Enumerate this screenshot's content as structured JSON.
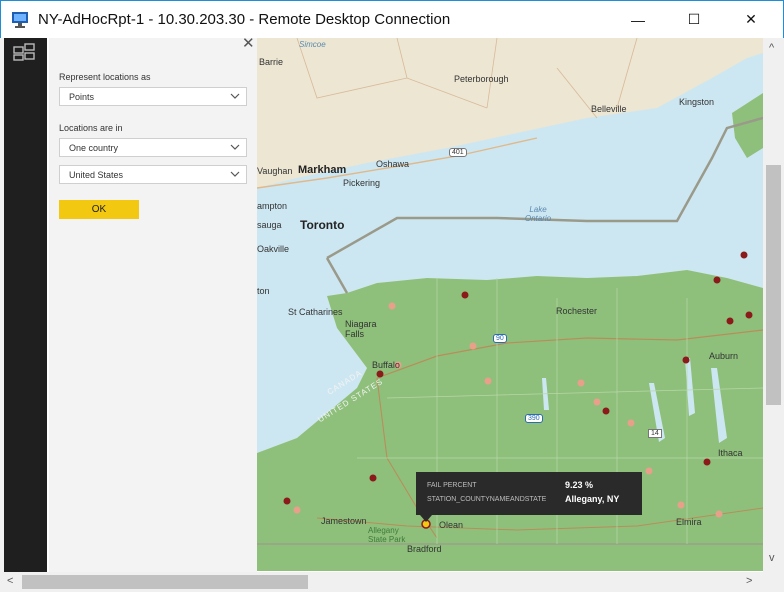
{
  "window": {
    "title": "NY-AdHocRpt-1 - 10.30.203.30 - Remote Desktop Connection",
    "controls": {
      "minimize": "—",
      "maximize": "☐",
      "close": "✕"
    }
  },
  "panel": {
    "close_glyph": "✕",
    "represent_label": "Represent locations as",
    "represent_value": "Points",
    "locations_label": "Locations are in",
    "scope_value": "One country",
    "country_value": "United States",
    "ok_label": "OK"
  },
  "map": {
    "places": [
      "Barrie",
      "Peterborough",
      "Belleville",
      "Kingston",
      "Vaughan",
      "Markham",
      "Oshawa",
      "Pickering",
      "Brampton",
      "Toronto",
      "Mississauga",
      "Oakville",
      "Burlington",
      "St Catharines",
      "Niagara Falls",
      "Rochester",
      "Buffalo",
      "Auburn",
      "Ithaca",
      "Jamestown",
      "Allegany State Park",
      "Olean",
      "Bradford",
      "Elmira",
      "Simcoe"
    ],
    "place_labels": {
      "barrie": "Barrie",
      "peterborough": "Peterborough",
      "belleville": "Belleville",
      "kingston": "Kingston",
      "vaughan": "Vaughan",
      "markham": "Markham",
      "oshawa": "Oshawa",
      "pickering": "Pickering",
      "brampton": "ampton",
      "toronto": "Toronto",
      "mississauga": "sauga",
      "oakville": "Oakville",
      "burlington": "ton",
      "stcatharines": "St Catharines",
      "niagara": "Niagara Falls",
      "rochester": "Rochester",
      "buffalo": "Buffalo",
      "auburn": "Auburn",
      "ithaca": "Ithaca",
      "jamestown": "Jamestown",
      "allegany_park": "Allegany State Park",
      "olean": "Olean",
      "bradford": "Bradford",
      "elmira": "Elmira",
      "simcoe": "Simcoe",
      "lake": "Lake Ontario",
      "canada": "CANADA",
      "united_states": "UNITED STATES",
      "hwy401a": "401",
      "hwy401b": "401",
      "hwy90": "90",
      "hwy390": "390",
      "hwy14": "14"
    },
    "colors": {
      "us_land": "#8ec07c",
      "water": "#cde7f2",
      "canada_land": "#ece6d2",
      "dark_point": "#8b1a1a",
      "light_point": "#e8a08a",
      "selected_point": "#f2c811"
    },
    "tooltip": {
      "fail_key": "FAIL PERCENT",
      "fail_value": "9.23 %",
      "station_key": "STATION_COUNTYNAMEANDSTATE",
      "station_value": "Allegany, NY"
    }
  },
  "scroll": {
    "left_arrow": "<",
    "right_arrow": ">",
    "up_arrow": "^",
    "down_arrow": "v"
  }
}
